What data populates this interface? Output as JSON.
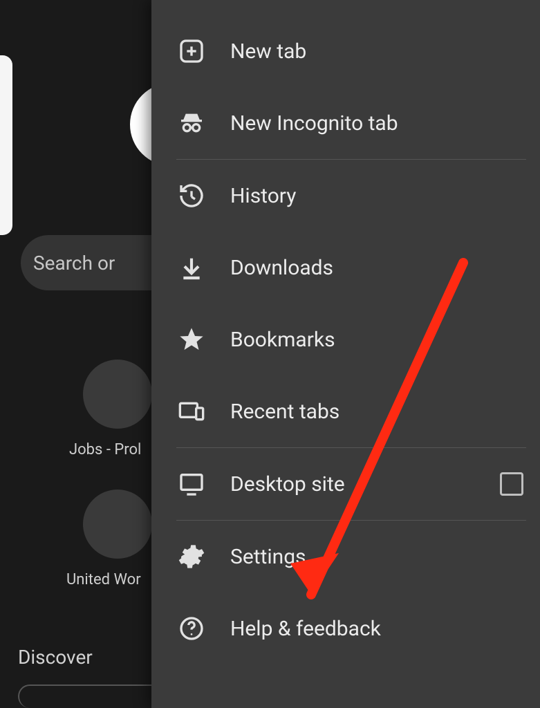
{
  "background": {
    "search_placeholder": "Search or",
    "tile1_label": "Jobs - Prol",
    "tile2_label": "United Wor",
    "discover_label": "Discover"
  },
  "menu": {
    "items": [
      {
        "label": "New tab",
        "icon": "plus-square"
      },
      {
        "label": "New Incognito tab",
        "icon": "incognito"
      },
      {
        "label": "History",
        "icon": "history"
      },
      {
        "label": "Downloads",
        "icon": "download"
      },
      {
        "label": "Bookmarks",
        "icon": "star"
      },
      {
        "label": "Recent tabs",
        "icon": "devices"
      },
      {
        "label": "Desktop site",
        "icon": "monitor",
        "checkbox": true
      },
      {
        "label": "Settings",
        "icon": "gear"
      },
      {
        "label": "Help & feedback",
        "icon": "help"
      }
    ]
  },
  "annotation": {
    "arrow_target": "Settings",
    "arrow_color": "#ff2a12"
  }
}
